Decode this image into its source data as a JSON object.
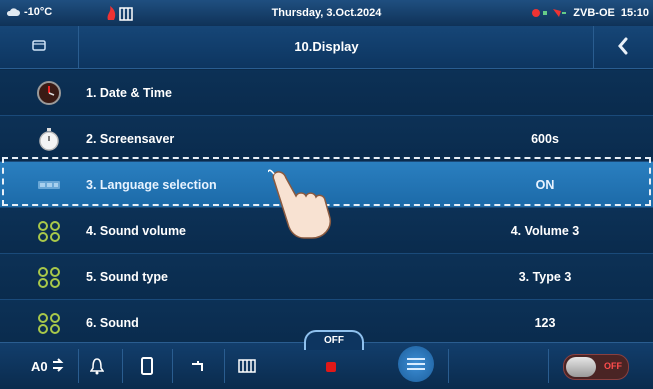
{
  "status": {
    "temperature": "-10°C",
    "date": "Thursday, 3.Oct.2024",
    "device": "ZVB-OE",
    "time": "15:10"
  },
  "header": {
    "title": "10.Display",
    "folder_icon": "folder-icon",
    "back_icon": "chevron-left-icon"
  },
  "rows": [
    {
      "label": "1. Date & Time",
      "value": "",
      "icon": "clock-icon"
    },
    {
      "label": "2. Screensaver",
      "value": "600s",
      "icon": "stopwatch-icon"
    },
    {
      "label": "3. Language selection",
      "value": "ON",
      "icon": "flag-icon"
    },
    {
      "label": "4. Sound volume",
      "value": "4. Volume 3",
      "icon": "dots-icon"
    },
    {
      "label": "5. Sound type",
      "value": "3. Type 3",
      "icon": "dots-icon"
    },
    {
      "label": "6. Sound",
      "value": "123",
      "icon": "dots-icon"
    }
  ],
  "footer": {
    "off_label": "OFF",
    "toggle_label": "OFF"
  },
  "colors": {
    "accent": "#1c6aa8",
    "background": "#0b2a4a",
    "off_red": "#e01818"
  }
}
